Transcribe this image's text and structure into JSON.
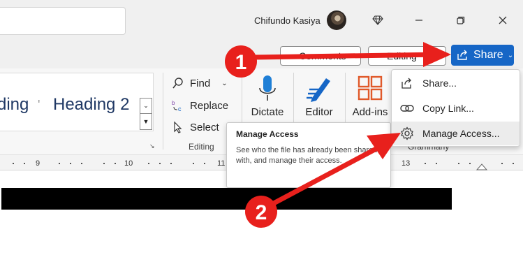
{
  "titlebar": {
    "user_name": "Chifundo Kasiya",
    "icons": [
      "diamond-icon",
      "minimize-icon",
      "restore-icon",
      "close-icon"
    ]
  },
  "collab": {
    "comments_label": "Comments",
    "editing_label": "Editing",
    "share_label": "Share"
  },
  "styles": {
    "heading1_partial": "ding",
    "heading2_label": "Heading 2"
  },
  "editing": {
    "find_label": "Find",
    "replace_label": "Replace",
    "select_label": "Select",
    "group_label": "Editing"
  },
  "tools": {
    "dictate_label": "Dictate",
    "editor_label": "Editor",
    "addins_label": "Add-ins",
    "grammarly_label": "Grammarly"
  },
  "share_menu": {
    "items": [
      {
        "label": "Share...",
        "icon": "share-icon"
      },
      {
        "label": "Copy Link...",
        "icon": "link-icon"
      },
      {
        "label": "Manage Access...",
        "icon": "gear-icon"
      }
    ]
  },
  "tooltip": {
    "title": "Manage Access",
    "body": "See who the file has already been shared with, and manage their access."
  },
  "ruler": {
    "ticks": [
      "9",
      "10",
      "11",
      "13"
    ]
  },
  "annotations": {
    "step1": "1",
    "step2": "2",
    "arrow_color": "#e8201c"
  },
  "colors": {
    "accent": "#1666c6",
    "heading": "#1f3864"
  }
}
